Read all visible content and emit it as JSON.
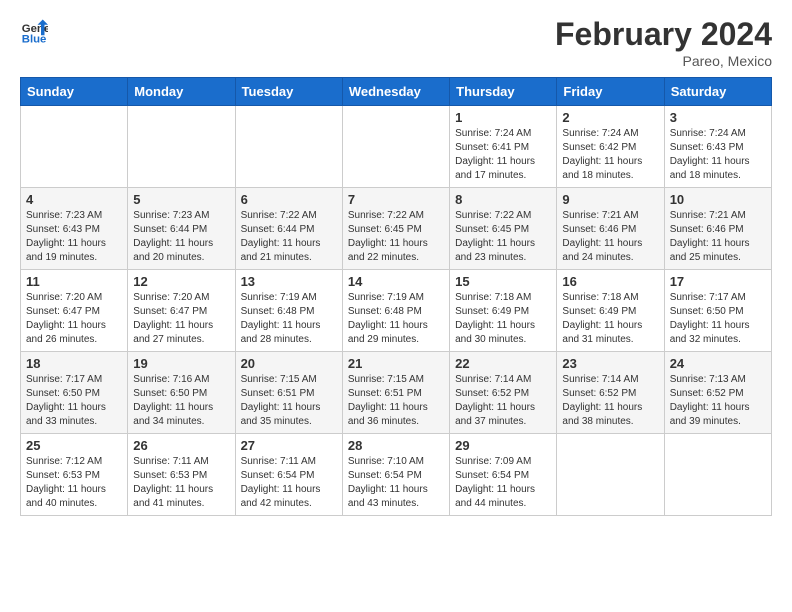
{
  "header": {
    "logo_general": "General",
    "logo_blue": "Blue",
    "month_title": "February 2024",
    "location": "Pareo, Mexico"
  },
  "days_of_week": [
    "Sunday",
    "Monday",
    "Tuesday",
    "Wednesday",
    "Thursday",
    "Friday",
    "Saturday"
  ],
  "weeks": [
    [
      {
        "day": null,
        "sunrise": null,
        "sunset": null,
        "daylight": null
      },
      {
        "day": null,
        "sunrise": null,
        "sunset": null,
        "daylight": null
      },
      {
        "day": null,
        "sunrise": null,
        "sunset": null,
        "daylight": null
      },
      {
        "day": null,
        "sunrise": null,
        "sunset": null,
        "daylight": null
      },
      {
        "day": "1",
        "sunrise": "Sunrise: 7:24 AM",
        "sunset": "Sunset: 6:41 PM",
        "daylight": "Daylight: 11 hours and 17 minutes."
      },
      {
        "day": "2",
        "sunrise": "Sunrise: 7:24 AM",
        "sunset": "Sunset: 6:42 PM",
        "daylight": "Daylight: 11 hours and 18 minutes."
      },
      {
        "day": "3",
        "sunrise": "Sunrise: 7:24 AM",
        "sunset": "Sunset: 6:43 PM",
        "daylight": "Daylight: 11 hours and 18 minutes."
      }
    ],
    [
      {
        "day": "4",
        "sunrise": "Sunrise: 7:23 AM",
        "sunset": "Sunset: 6:43 PM",
        "daylight": "Daylight: 11 hours and 19 minutes."
      },
      {
        "day": "5",
        "sunrise": "Sunrise: 7:23 AM",
        "sunset": "Sunset: 6:44 PM",
        "daylight": "Daylight: 11 hours and 20 minutes."
      },
      {
        "day": "6",
        "sunrise": "Sunrise: 7:22 AM",
        "sunset": "Sunset: 6:44 PM",
        "daylight": "Daylight: 11 hours and 21 minutes."
      },
      {
        "day": "7",
        "sunrise": "Sunrise: 7:22 AM",
        "sunset": "Sunset: 6:45 PM",
        "daylight": "Daylight: 11 hours and 22 minutes."
      },
      {
        "day": "8",
        "sunrise": "Sunrise: 7:22 AM",
        "sunset": "Sunset: 6:45 PM",
        "daylight": "Daylight: 11 hours and 23 minutes."
      },
      {
        "day": "9",
        "sunrise": "Sunrise: 7:21 AM",
        "sunset": "Sunset: 6:46 PM",
        "daylight": "Daylight: 11 hours and 24 minutes."
      },
      {
        "day": "10",
        "sunrise": "Sunrise: 7:21 AM",
        "sunset": "Sunset: 6:46 PM",
        "daylight": "Daylight: 11 hours and 25 minutes."
      }
    ],
    [
      {
        "day": "11",
        "sunrise": "Sunrise: 7:20 AM",
        "sunset": "Sunset: 6:47 PM",
        "daylight": "Daylight: 11 hours and 26 minutes."
      },
      {
        "day": "12",
        "sunrise": "Sunrise: 7:20 AM",
        "sunset": "Sunset: 6:47 PM",
        "daylight": "Daylight: 11 hours and 27 minutes."
      },
      {
        "day": "13",
        "sunrise": "Sunrise: 7:19 AM",
        "sunset": "Sunset: 6:48 PM",
        "daylight": "Daylight: 11 hours and 28 minutes."
      },
      {
        "day": "14",
        "sunrise": "Sunrise: 7:19 AM",
        "sunset": "Sunset: 6:48 PM",
        "daylight": "Daylight: 11 hours and 29 minutes."
      },
      {
        "day": "15",
        "sunrise": "Sunrise: 7:18 AM",
        "sunset": "Sunset: 6:49 PM",
        "daylight": "Daylight: 11 hours and 30 minutes."
      },
      {
        "day": "16",
        "sunrise": "Sunrise: 7:18 AM",
        "sunset": "Sunset: 6:49 PM",
        "daylight": "Daylight: 11 hours and 31 minutes."
      },
      {
        "day": "17",
        "sunrise": "Sunrise: 7:17 AM",
        "sunset": "Sunset: 6:50 PM",
        "daylight": "Daylight: 11 hours and 32 minutes."
      }
    ],
    [
      {
        "day": "18",
        "sunrise": "Sunrise: 7:17 AM",
        "sunset": "Sunset: 6:50 PM",
        "daylight": "Daylight: 11 hours and 33 minutes."
      },
      {
        "day": "19",
        "sunrise": "Sunrise: 7:16 AM",
        "sunset": "Sunset: 6:50 PM",
        "daylight": "Daylight: 11 hours and 34 minutes."
      },
      {
        "day": "20",
        "sunrise": "Sunrise: 7:15 AM",
        "sunset": "Sunset: 6:51 PM",
        "daylight": "Daylight: 11 hours and 35 minutes."
      },
      {
        "day": "21",
        "sunrise": "Sunrise: 7:15 AM",
        "sunset": "Sunset: 6:51 PM",
        "daylight": "Daylight: 11 hours and 36 minutes."
      },
      {
        "day": "22",
        "sunrise": "Sunrise: 7:14 AM",
        "sunset": "Sunset: 6:52 PM",
        "daylight": "Daylight: 11 hours and 37 minutes."
      },
      {
        "day": "23",
        "sunrise": "Sunrise: 7:14 AM",
        "sunset": "Sunset: 6:52 PM",
        "daylight": "Daylight: 11 hours and 38 minutes."
      },
      {
        "day": "24",
        "sunrise": "Sunrise: 7:13 AM",
        "sunset": "Sunset: 6:52 PM",
        "daylight": "Daylight: 11 hours and 39 minutes."
      }
    ],
    [
      {
        "day": "25",
        "sunrise": "Sunrise: 7:12 AM",
        "sunset": "Sunset: 6:53 PM",
        "daylight": "Daylight: 11 hours and 40 minutes."
      },
      {
        "day": "26",
        "sunrise": "Sunrise: 7:11 AM",
        "sunset": "Sunset: 6:53 PM",
        "daylight": "Daylight: 11 hours and 41 minutes."
      },
      {
        "day": "27",
        "sunrise": "Sunrise: 7:11 AM",
        "sunset": "Sunset: 6:54 PM",
        "daylight": "Daylight: 11 hours and 42 minutes."
      },
      {
        "day": "28",
        "sunrise": "Sunrise: 7:10 AM",
        "sunset": "Sunset: 6:54 PM",
        "daylight": "Daylight: 11 hours and 43 minutes."
      },
      {
        "day": "29",
        "sunrise": "Sunrise: 7:09 AM",
        "sunset": "Sunset: 6:54 PM",
        "daylight": "Daylight: 11 hours and 44 minutes."
      },
      {
        "day": null,
        "sunrise": null,
        "sunset": null,
        "daylight": null
      },
      {
        "day": null,
        "sunrise": null,
        "sunset": null,
        "daylight": null
      }
    ]
  ]
}
